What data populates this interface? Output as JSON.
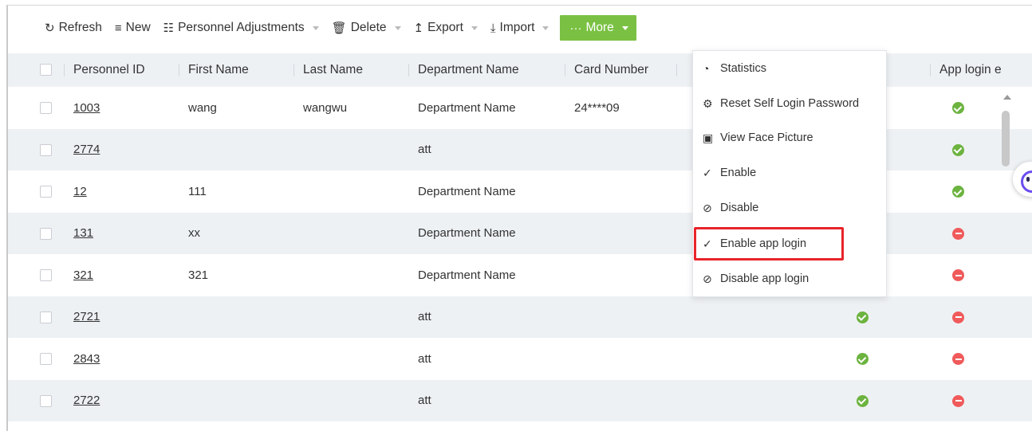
{
  "toolbar": {
    "refresh": {
      "icon": "refresh-icon",
      "label": "Refresh"
    },
    "new": {
      "icon": "add-list-icon",
      "label": "New"
    },
    "adjust": {
      "icon": "org-tree-icon",
      "label": "Personnel Adjustments"
    },
    "delete": {
      "icon": "trash-icon",
      "label": "Delete"
    },
    "export": {
      "icon": "export-icon",
      "label": "Export"
    },
    "import": {
      "icon": "import-icon",
      "label": "Import"
    },
    "more": {
      "icon": "ellipsis-icon",
      "label": "More"
    },
    "more_color": "#7ac143"
  },
  "table": {
    "columns": [
      "Personnel ID",
      "First Name",
      "Last Name",
      "Department Name",
      "Card Number",
      "",
      "",
      "App login e"
    ],
    "rows": [
      {
        "id": "1003",
        "first": "wang",
        "last": "wangwu",
        "dept": "Department Name",
        "card": "24****09",
        "status1": "",
        "app": "ok"
      },
      {
        "id": "2774",
        "first": "",
        "last": "",
        "dept": "att",
        "card": "",
        "status1": "",
        "app": "ok"
      },
      {
        "id": "12",
        "first": "111",
        "last": "",
        "dept": "Department Name",
        "card": "",
        "status1": "",
        "app": "ok"
      },
      {
        "id": "131",
        "first": "xx",
        "last": "",
        "dept": "Department Name",
        "card": "",
        "status1": "",
        "app": "no"
      },
      {
        "id": "321",
        "first": "321",
        "last": "",
        "dept": "Department Name",
        "card": "",
        "status1": "",
        "app": "no"
      },
      {
        "id": "2721",
        "first": "",
        "last": "",
        "dept": "att",
        "card": "",
        "status1": "ok",
        "app": "no"
      },
      {
        "id": "2843",
        "first": "",
        "last": "",
        "dept": "att",
        "card": "",
        "status1": "ok",
        "app": "no"
      },
      {
        "id": "2722",
        "first": "",
        "last": "",
        "dept": "att",
        "card": "",
        "status1": "ok",
        "app": "no"
      }
    ]
  },
  "more_menu": {
    "items": [
      {
        "icon": "pie-chart-icon",
        "label": "Statistics"
      },
      {
        "icon": "gear-icon",
        "label": "Reset Self Login Password"
      },
      {
        "icon": "face-picture-icon",
        "label": "View Face Picture"
      },
      {
        "icon": "check-icon",
        "label": "Enable"
      },
      {
        "icon": "prohibited-icon",
        "label": "Disable"
      },
      {
        "icon": "check-icon",
        "label": "Enable app login"
      },
      {
        "icon": "prohibited-icon",
        "label": "Disable app login"
      }
    ]
  },
  "colors": {
    "ok": "#6cb33f",
    "no": "#f05a5a",
    "highlight": "#e8242a"
  }
}
